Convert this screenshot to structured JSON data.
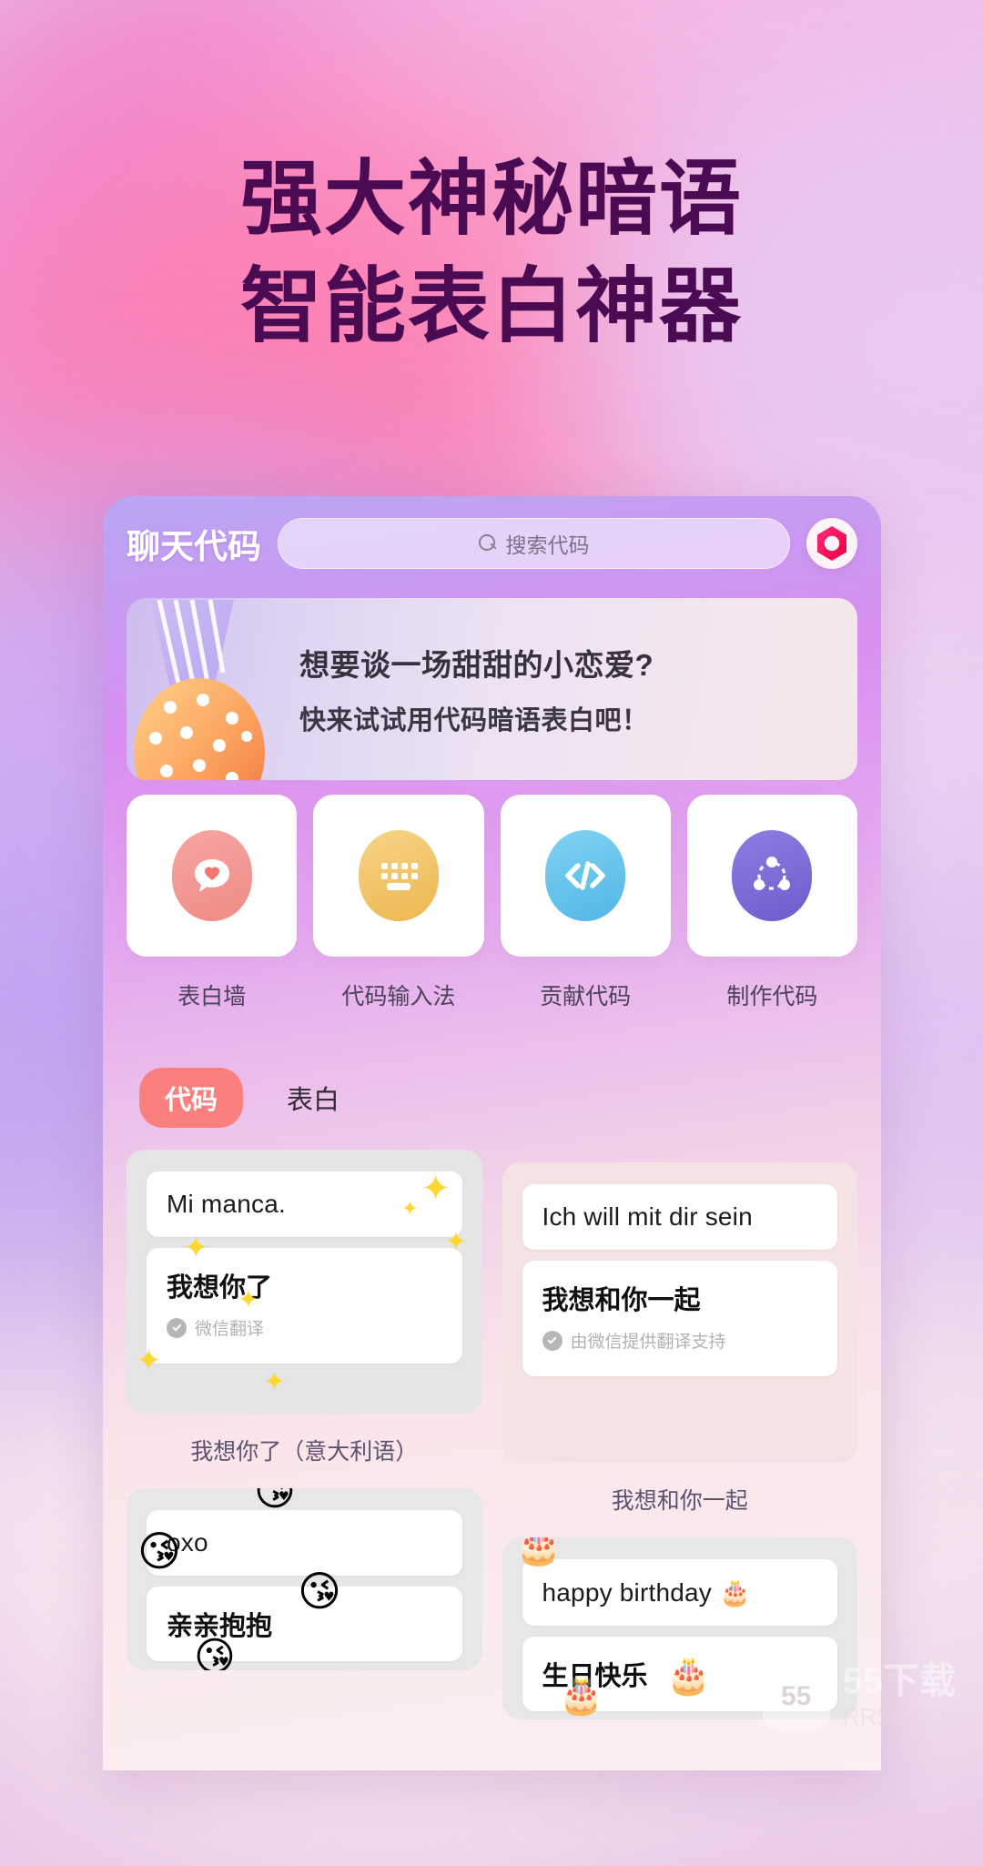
{
  "hero": {
    "line1": "强大神秘暗语",
    "line2": "智能表白神器",
    "color": "#4a0b52"
  },
  "app": {
    "title": "聊天代码",
    "logo_icon": "hexagon-logo-icon",
    "accent": "#f9807e",
    "search": {
      "icon": "search-icon",
      "placeholder": "搜索代码",
      "value": ""
    }
  },
  "banner": {
    "icon": "strawberry-icecream-icon",
    "line1": "想要谈一场甜甜的小恋爱?",
    "line2": "快来试试用代码暗语表白吧！"
  },
  "quick_actions": [
    {
      "label": "表白墙",
      "icon": "heart-bubble-icon",
      "color": "#f4948f"
    },
    {
      "label": "代码输入法",
      "icon": "keyboard-icon",
      "color": "#f0c濯"
    },
    {
      "label": "贡献代码",
      "icon": "code-brackets-icon",
      "color": "#68c3ec"
    },
    {
      "label": "制作代码",
      "icon": "share-nodes-icon",
      "color": "#7b6bd6"
    }
  ],
  "tabs": [
    {
      "label": "代码",
      "active": true
    },
    {
      "label": "表白",
      "active": false
    }
  ],
  "cards": [
    {
      "foreign": "Mi manca.",
      "chinese": "我想你了",
      "translator": "微信翻译",
      "caption": "我想你了（意大利语）",
      "decor": "sparkles"
    },
    {
      "foreign": "Ich will mit dir sein",
      "chinese": "我想和你一起",
      "translator": "由微信提供翻译支持",
      "caption": "我想和你一起",
      "decor": "none"
    },
    {
      "foreign": "oxo",
      "chinese": "亲亲抱抱",
      "translator": "",
      "caption": "",
      "decor": "kiss-emoji"
    },
    {
      "foreign": "happy birthday 🎂",
      "chinese": "生日快乐",
      "translator": "",
      "caption": "",
      "decor": "cake-emoji"
    }
  ],
  "watermark": {
    "mark": "55",
    "name": "55下载",
    "site": "RR55.COM"
  }
}
